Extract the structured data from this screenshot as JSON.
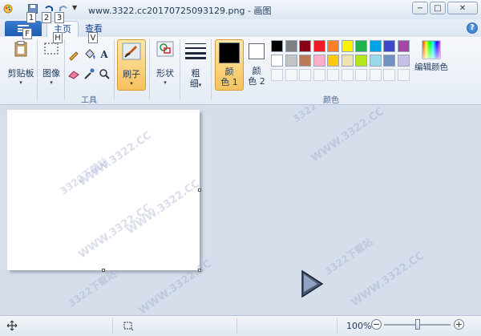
{
  "window": {
    "title": "www.3322.cc20170725093129.png - 画图",
    "minimize_glyph": "−",
    "maximize_glyph": "□",
    "close_glyph": "✕"
  },
  "keytips": {
    "qat_1": "1",
    "qat_2": "2",
    "qat_3": "3",
    "file": "F",
    "home": "H",
    "view": "V"
  },
  "tabs": {
    "home": "主页",
    "view": "查看"
  },
  "help_glyph": "?",
  "ribbon": {
    "clipboard": {
      "label": "剪贴板"
    },
    "image": {
      "label": "图像"
    },
    "tools": {
      "group_label": "工具",
      "text_glyph": "A"
    },
    "brushes": {
      "label": "刷子"
    },
    "shapes": {
      "label": "形状"
    },
    "size": {
      "label_line1": "粗",
      "label_line2": "细"
    },
    "color1": {
      "label_line1": "颜",
      "label_line2": "色 1"
    },
    "color2": {
      "label_line1": "颜",
      "label_line2": "色 2"
    },
    "colors_group_label": "颜色",
    "edit_colors": {
      "label": "编辑颜色"
    },
    "caret": "▾"
  },
  "palette": {
    "row1": [
      "#000000",
      "#7f7f7f",
      "#880015",
      "#ed1c24",
      "#ff7f27",
      "#fff200",
      "#22b14c",
      "#00a2e8",
      "#3f48cc",
      "#a349a4"
    ],
    "row2": [
      "#ffffff",
      "#c3c3c3",
      "#b97a57",
      "#ffaec9",
      "#ffc90e",
      "#efe4b0",
      "#b5e61d",
      "#99d9ea",
      "#7092be",
      "#c8bfe7"
    ],
    "row3": [
      "#f4f6f9",
      "#f4f6f9",
      "#f4f6f9",
      "#f4f6f9",
      "#f4f6f9",
      "#f4f6f9",
      "#f4f6f9",
      "#f4f6f9",
      "#f4f6f9",
      "#f4f6f9"
    ],
    "color1_value": "#000000",
    "color2_value": "#ffffff"
  },
  "watermark": {
    "text": "WWW.3322.CC",
    "cn_text": "3322下载站"
  },
  "statusbar": {
    "zoom_label": "100%",
    "zoom_out": "−",
    "zoom_in": "+",
    "zoom_fraction": 0.5
  }
}
